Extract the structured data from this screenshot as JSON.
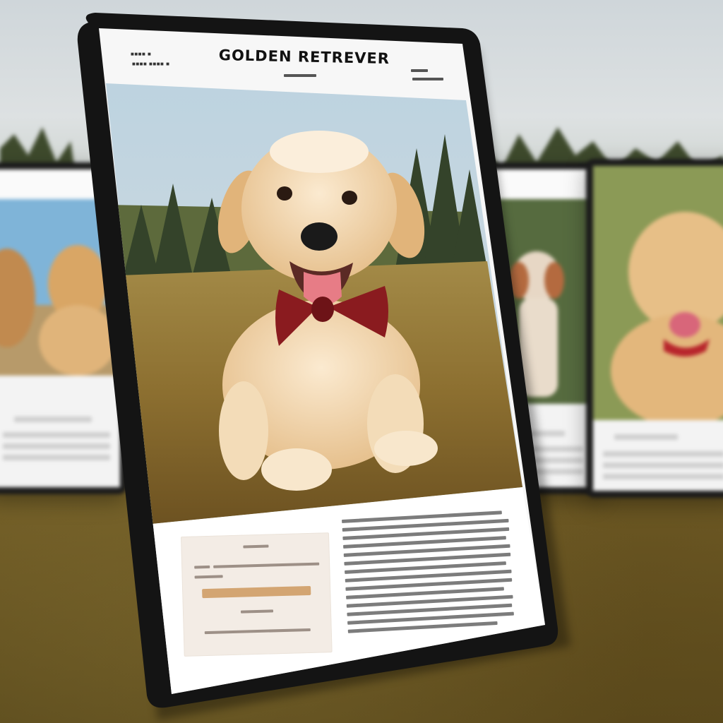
{
  "page": {
    "title": "GOLDEN RETREVER"
  },
  "colors": {
    "tablet_frame": "#141414",
    "screen_bg": "#f7f7f7",
    "bow_tie": "#8a1b1f",
    "puppy_fur": "#f1d8b0",
    "cta_bar": "#d3a572"
  },
  "icons": [
    "bow-tie-icon"
  ]
}
